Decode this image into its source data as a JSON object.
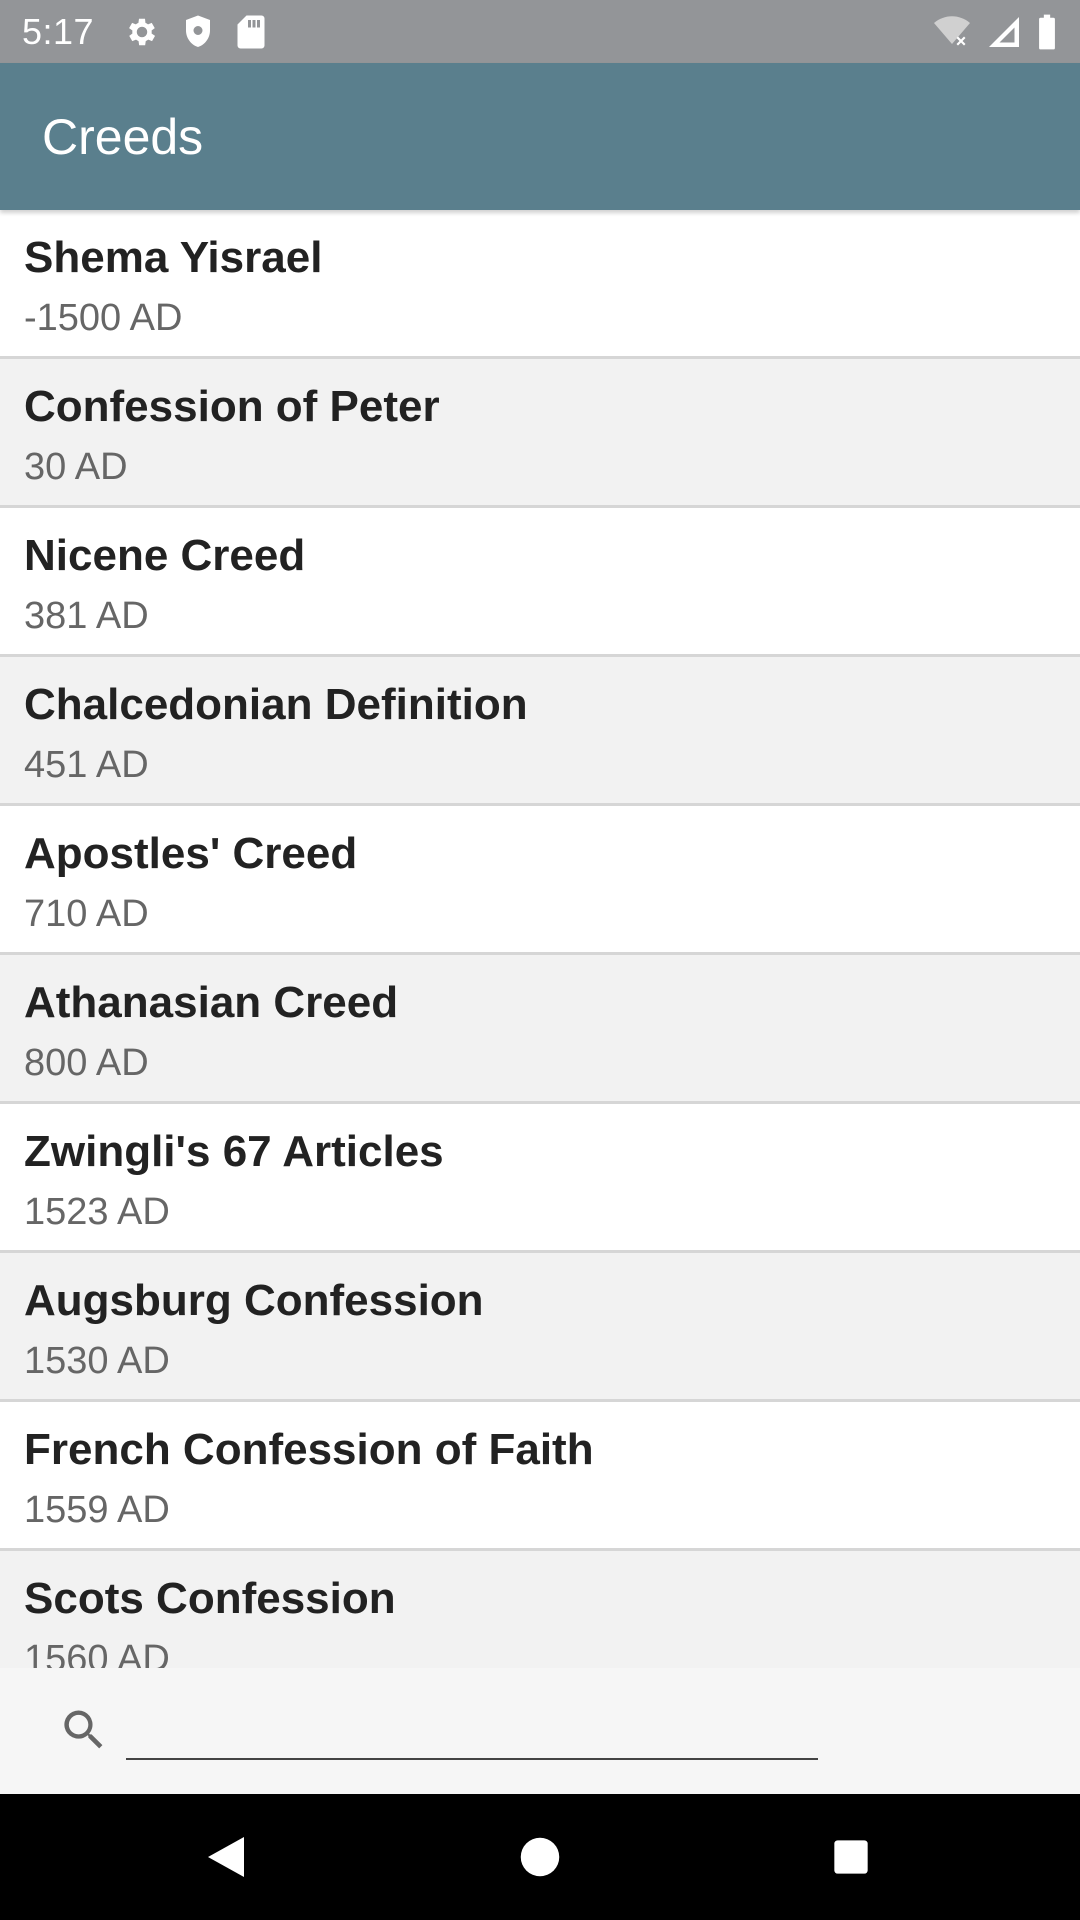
{
  "status_bar": {
    "time": "5:17",
    "left_icons": [
      "gear-icon",
      "shield-icon",
      "sd-card-icon"
    ],
    "right_icons": [
      "wifi-off-icon",
      "cell-signal-icon",
      "battery-icon"
    ]
  },
  "app_bar": {
    "title": "Creeds"
  },
  "creeds": [
    {
      "name": "Shema Yisrael",
      "date": "-1500 AD"
    },
    {
      "name": "Confession of Peter",
      "date": "30 AD"
    },
    {
      "name": "Nicene Creed",
      "date": "381 AD"
    },
    {
      "name": "Chalcedonian Definition",
      "date": "451 AD"
    },
    {
      "name": "Apostles' Creed",
      "date": "710 AD"
    },
    {
      "name": "Athanasian Creed",
      "date": "800 AD"
    },
    {
      "name": "Zwingli's 67 Articles",
      "date": "1523 AD"
    },
    {
      "name": "Augsburg Confession",
      "date": "1530 AD"
    },
    {
      "name": "French Confession of Faith",
      "date": "1559 AD"
    },
    {
      "name": "Scots Confession",
      "date": "1560 AD"
    }
  ],
  "search": {
    "value": "",
    "icon": "search-icon"
  },
  "nav_bar": {
    "buttons": [
      "back-icon",
      "home-icon",
      "recents-icon"
    ]
  },
  "colors": {
    "status_bar": "#939598",
    "app_bar": "#5a7f8d",
    "row_alt": "#f2f2f2",
    "row_white": "#ffffff",
    "divider": "#d6d6d6"
  }
}
